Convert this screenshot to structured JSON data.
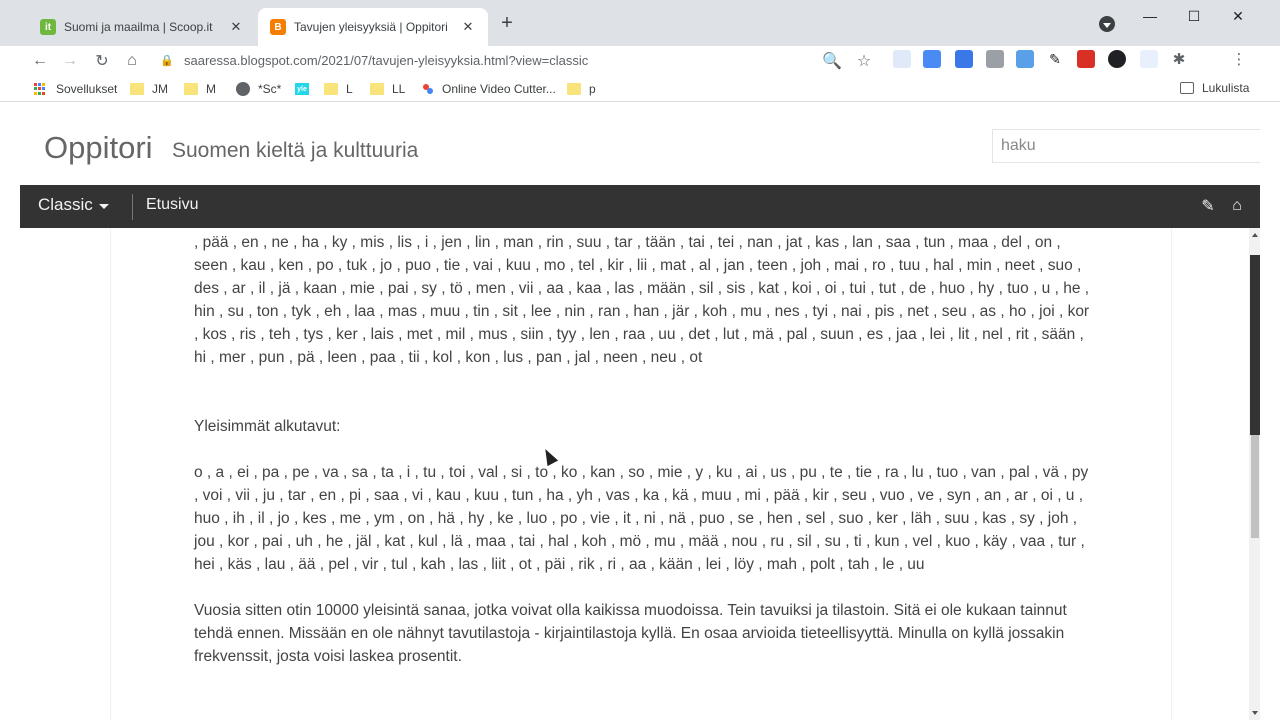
{
  "browser": {
    "tabs": [
      {
        "title": "Suomi ja maailma | Scoop.it",
        "favicon_color": "#6fb83f",
        "favicon_text": "it"
      },
      {
        "title": "Tavujen yleisyyksiä | Oppitori",
        "favicon_color": "#f57d00",
        "favicon_text": "B"
      }
    ],
    "new_tab_label": "+",
    "url": "saaressa.blogspot.com/2021/07/tavujen-yleisyyksia.html?view=classic",
    "bookmarks": [
      {
        "label": "Sovellukset",
        "type": "apps"
      },
      {
        "label": "JM",
        "type": "folder"
      },
      {
        "label": "M",
        "type": "folder"
      },
      {
        "label": "*Sc*",
        "type": "globe"
      },
      {
        "label": "yle",
        "type": "yle"
      },
      {
        "label": "L",
        "type": "folder"
      },
      {
        "label": "LL",
        "type": "folder"
      },
      {
        "label": "Online Video Cutter...",
        "type": "ovc"
      },
      {
        "label": "p",
        "type": "folder"
      }
    ],
    "reading_list": "Lukulista"
  },
  "blog": {
    "title": "Oppitori",
    "description": "Suomen kieltä ja kulttuuria",
    "search_placeholder": "haku",
    "nav": {
      "view": "Classic",
      "home": "Etusivu"
    }
  },
  "article": {
    "syllables_list": ", pää , en , ne , ha , ky , mis , lis , i , jen , lin , man , rin , suu , tar , tään , tai , tei , nan , jat , kas , lan , saa , tun , maa , del , on , seen , kau , ken , po , tuk , jo , puo , tie , vai , kuu , mo , tel , kir , lii , mat , al , jan , teen , joh , mai , ro , tuu , hal , min , neet , suo , des , ar , il , jä , kaan , mie , pai , sy , tö , men , vii , aa , kaa , las , mään , sil , sis , kat , koi , oi , tui , tut , de , huo , hy , tuo , u , he , hin , su , ton , tyk , eh , laa , mas , muu , tin , sit , lee , nin , ran , han , jär , koh , mu , nes , tyi , nai , pis , net , seu , as , ho , joi , kor , kos , ris , teh , tys , ker , lais , met , mil , mus , siin , tyy , len , raa , uu , det , lut , mä , pal , suun , es , jaa , lei , lit , nel , rit , sään , hi , mer , pun , pä , leen , paa , tii , kol , kon , lus , pan , jal , neen , neu , ot",
    "heading_initial": "Yleisimmät alkutavut:",
    "initial_list": "o , a , ei , pa , pe , va , sa , ta , i , tu , toi , val , si , to , ko , kan , so , mie , y , ku , ai , us , pu , te , tie , ra , lu , tuo , van , pal , vä , py , voi , vii , ju , tar , en , pi , saa , vi , kau , kuu , tun , ha , yh , vas , ka , kä , muu , mi , pää , kir , seu , vuo , ve , syn , an , ar , oi , u , huo , ih , il , jo , kes , me , ym , on , hä , hy , ke , luo , po , vie , it , ni , nä , puo , se , hen , sel , suo , ker , läh , suu , kas , sy , joh , jou , kor , pai , uh , he , jäl , kat , kul , lä , maa , tai , hal , koh , mö , mu , mää , nou , ru , sil , su , ti , kun , vel , kuo , käy , vaa , tur , hei , käs , lau , ää , pel , vir , tul , kah , las , liit , ot , päi , rik , ri , aa , kään , lei , löy , mah , polt , tah , le , uu",
    "closing_paragraph": "Vuosia sitten otin 10000 yleisintä sanaa, jotka voivat olla kaikissa muodoissa. Tein tavuiksi ja tilastoin. Sitä ei ole kukaan tainnut tehdä ennen. Missään en ole nähnyt tavutilastoja - kirjaintilastoja kyllä. En osaa arvioida tieteellisyyttä. Minulla on kyllä jossakin frekvenssit, josta voisi laskea prosentit."
  }
}
